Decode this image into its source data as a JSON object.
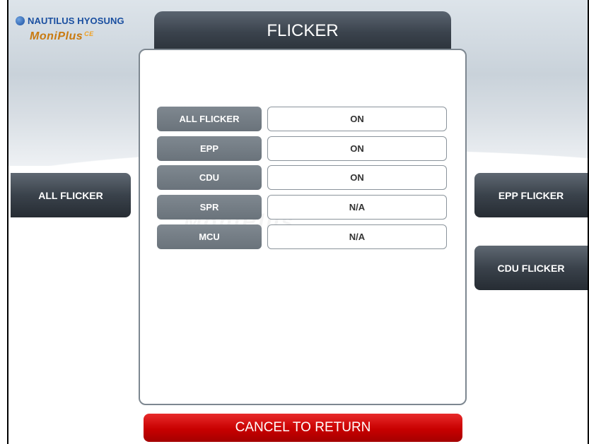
{
  "logo": {
    "brand": "NAUTILUS HYOSUNG",
    "product": "MoniPlus",
    "product_suffix": "CE"
  },
  "screen": {
    "title": "FLICKER"
  },
  "watermark": "MoniPlus",
  "rows": [
    {
      "label": "ALL FLICKER",
      "value": "ON"
    },
    {
      "label": "EPP",
      "value": "ON"
    },
    {
      "label": "CDU",
      "value": "ON"
    },
    {
      "label": "SPR",
      "value": "N/A"
    },
    {
      "label": "MCU",
      "value": "N/A"
    }
  ],
  "buttons": {
    "all_flicker": "ALL FLICKER",
    "epp_flicker": "EPP FLICKER",
    "cdu_flicker": "CDU FLICKER",
    "cancel": "CANCEL TO RETURN"
  },
  "colors": {
    "brand_blue": "#1a4fa0",
    "cancel_red": "#d40000",
    "button_dark": "#3a424b"
  }
}
